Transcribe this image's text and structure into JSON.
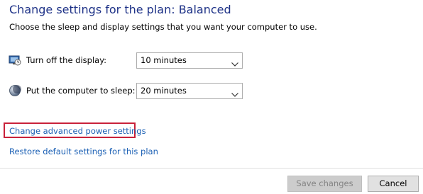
{
  "title": "Change settings for the plan: Balanced",
  "subtitle": "Choose the sleep and display settings that you want your computer to use.",
  "settings": [
    {
      "label": "Turn off the display:",
      "value": "10 minutes",
      "icon": "display-clock-icon"
    },
    {
      "label": "Put the computer to sleep:",
      "value": "20 minutes",
      "icon": "moon-sleep-icon"
    }
  ],
  "links": {
    "advanced": "Change advanced power settings",
    "restore": "Restore default settings for this plan"
  },
  "buttons": {
    "save": "Save changes",
    "cancel": "Cancel"
  },
  "colors": {
    "title": "#1e3287",
    "link": "#1a5fb4",
    "highlight_border": "#c9213a",
    "disabled_button": "#cccccc"
  }
}
